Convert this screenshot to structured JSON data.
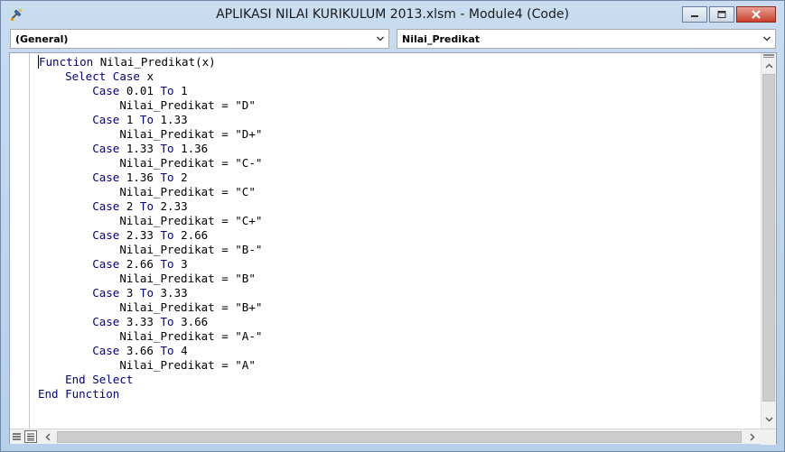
{
  "window": {
    "title": "APLIKASI NILAI KURIKULUM 2013.xlsm - Module4 (Code)"
  },
  "combos": {
    "object": "(General)",
    "procedure": "Nilai_Predikat"
  },
  "code": {
    "lines": [
      "Function Nilai_Predikat(x)",
      "    Select Case x",
      "        Case 0.01 To 1",
      "            Nilai_Predikat = \"D\"",
      "        Case 1 To 1.33",
      "            Nilai_Predikat = \"D+\"",
      "        Case 1.33 To 1.36",
      "            Nilai_Predikat = \"C-\"",
      "        Case 1.36 To 2",
      "            Nilai_Predikat = \"C\"",
      "        Case 2 To 2.33",
      "            Nilai_Predikat = \"C+\"",
      "        Case 2.33 To 2.66",
      "            Nilai_Predikat = \"B-\"",
      "        Case 2.66 To 3",
      "            Nilai_Predikat = \"B\"",
      "        Case 3 To 3.33",
      "            Nilai_Predikat = \"B+\"",
      "        Case 3.33 To 3.66",
      "            Nilai_Predikat = \"A-\"",
      "        Case 3.66 To 4",
      "            Nilai_Predikat = \"A\"",
      "    End Select",
      "End Function"
    ],
    "keywords": [
      "Function",
      "Select",
      "Case",
      "To",
      "End"
    ],
    "keyword_color": "#00007f",
    "text_color": "#000000"
  },
  "icons": {
    "app": "vba-editor-icon",
    "minimize": "minimize-icon",
    "maximize": "maximize-icon",
    "close": "close-icon"
  }
}
